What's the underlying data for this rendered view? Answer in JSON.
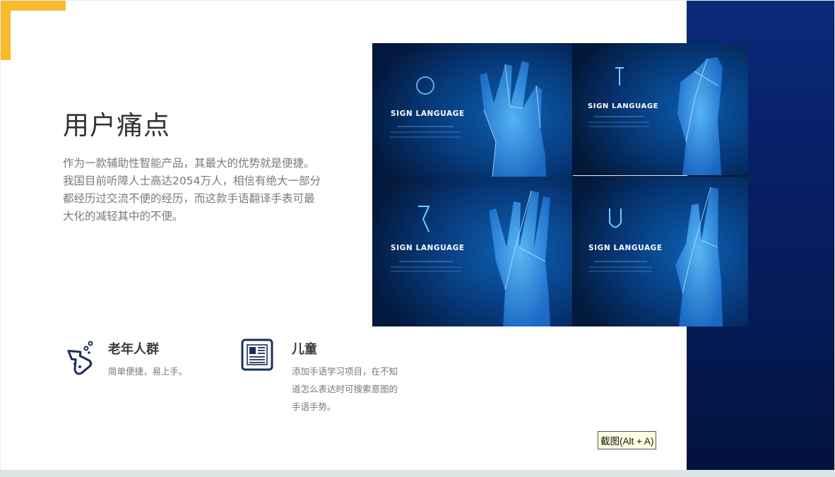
{
  "slide": {
    "title": "用户痛点",
    "description_lines": [
      "作为一款辅助性智能产品，其最大的优势就是便捷。",
      "我国目前听障人士高达2054万人，相信有绝大一部分",
      "都经历过交流不便的经历，而这款手语翻译手表可最",
      "大化的减轻其中的不便。"
    ],
    "photo": {
      "labels": [
        "SIGN LANGUAGE",
        "SIGN LANGUAGE",
        "SIGN LANGUAGE",
        "SIGN LANGUAGE"
      ]
    },
    "features": [
      {
        "icon": "flask-icon",
        "title": "老年人群",
        "text_lines": [
          "简单便捷，易上手。"
        ]
      },
      {
        "icon": "newspaper-icon",
        "title": "儿童",
        "text_lines": [
          "添加手语学习项目，在不知",
          "道怎么表达时可搜索意图的",
          "手语手势。"
        ]
      }
    ]
  },
  "tooltip": {
    "text": "截图(Alt + A)"
  },
  "colors": {
    "accent": "#f9b92a",
    "panel": "#08206a",
    "icon": "#1a2f5e"
  }
}
